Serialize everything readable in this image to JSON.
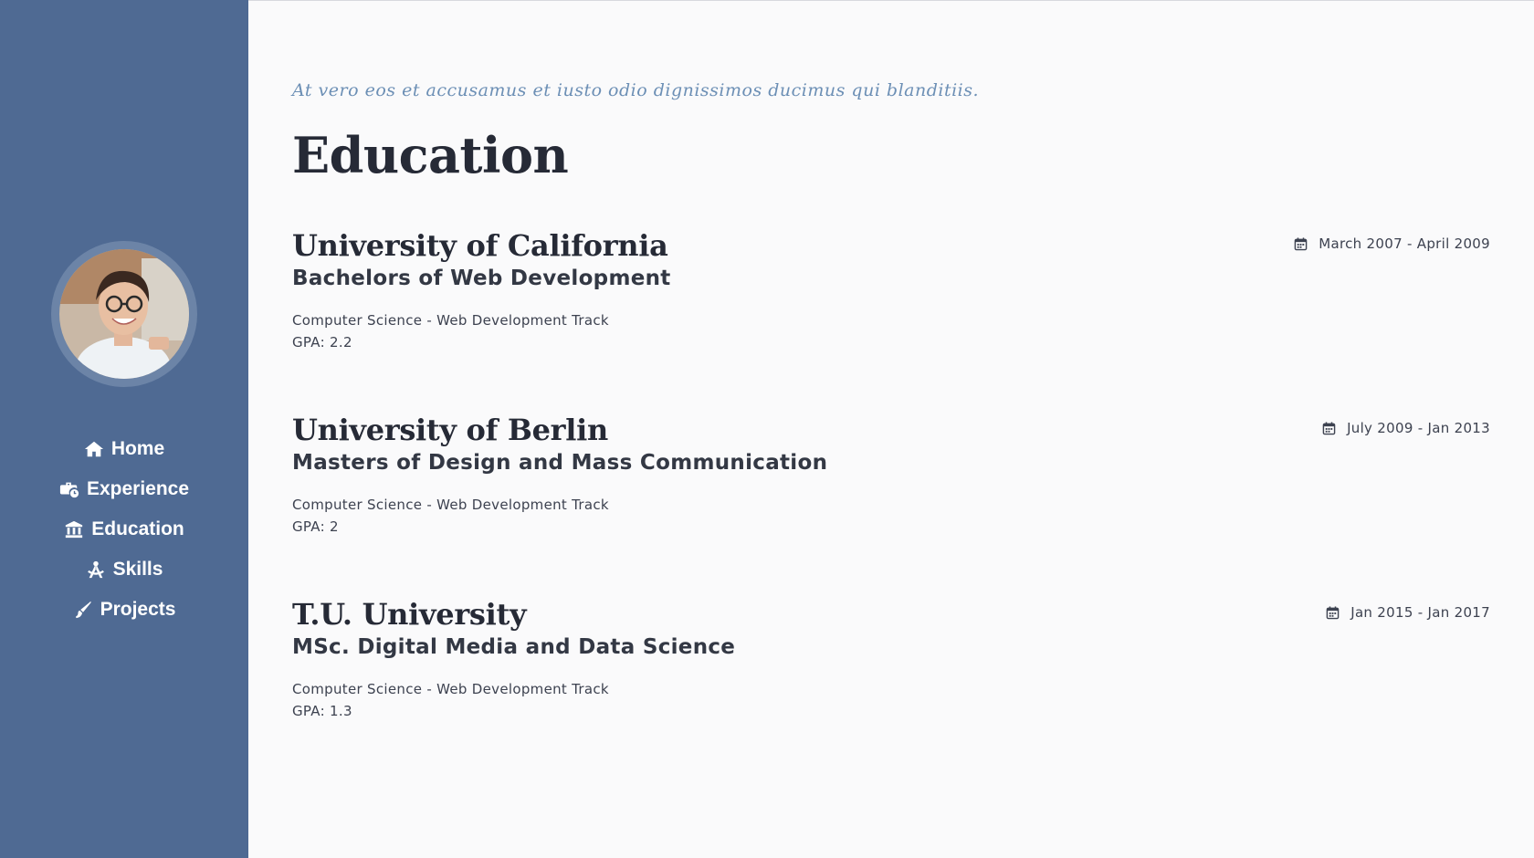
{
  "sidebar": {
    "avatar_icon": "profile-photo",
    "nav": [
      {
        "label": "Home",
        "icon": "home-icon"
      },
      {
        "label": "Experience",
        "icon": "briefcase-clock-icon"
      },
      {
        "label": "Education",
        "icon": "university-icon"
      },
      {
        "label": "Skills",
        "icon": "drafting-compass-icon"
      },
      {
        "label": "Projects",
        "icon": "paint-brush-icon"
      }
    ]
  },
  "main": {
    "tagline": "At vero eos et accusamus et iusto odio dignissimos ducimus qui blanditiis.",
    "title": "Education",
    "entries": [
      {
        "school": "University of California",
        "degree": "Bachelors of Web Development",
        "track": "Computer Science - Web Development Track",
        "gpa": "GPA: 2.2",
        "dates": "March 2007 - April 2009"
      },
      {
        "school": "University of Berlin",
        "degree": "Masters of Design and Mass Communication",
        "track": "Computer Science - Web Development Track",
        "gpa": "GPA: 2",
        "dates": "July 2009 - Jan 2013"
      },
      {
        "school": "T.U. University",
        "degree": "MSc. Digital Media and Data Science",
        "track": "Computer Science - Web Development Track",
        "gpa": "GPA: 1.3",
        "dates": "Jan 2015 - Jan 2017"
      }
    ]
  },
  "colors": {
    "sidebar_bg": "#4f6a93",
    "page_bg": "#fafafb",
    "tagline": "#6c8fb5",
    "heading": "#262a36"
  }
}
